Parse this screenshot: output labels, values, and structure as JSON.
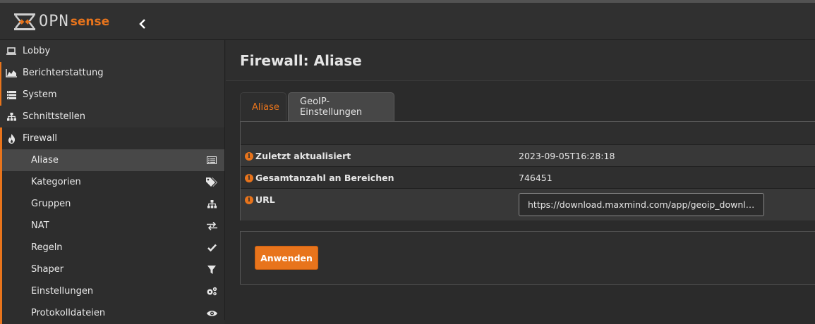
{
  "brand": {
    "logo_text": "OPN",
    "logo_sense": "sense",
    "accent_color": "#e8741c"
  },
  "topbar": {
    "collapse_icon": "chevron-left-icon"
  },
  "sidebar": {
    "items": [
      {
        "label": "Lobby",
        "icon": "laptop-icon"
      },
      {
        "label": "Berichterstattung",
        "icon": "area-chart-icon"
      },
      {
        "label": "System",
        "icon": "server-icon"
      },
      {
        "label": "Schnittstellen",
        "icon": "sitemap-icon"
      },
      {
        "label": "Firewall",
        "icon": "fire-icon"
      }
    ],
    "firewall_sub": [
      {
        "label": "Aliase",
        "icon": "list-alt-icon"
      },
      {
        "label": "Kategorien",
        "icon": "tags-icon"
      },
      {
        "label": "Gruppen",
        "icon": "sitemap-icon"
      },
      {
        "label": "NAT",
        "icon": "exchange-icon"
      },
      {
        "label": "Regeln",
        "icon": "check-icon"
      },
      {
        "label": "Shaper",
        "icon": "filter-icon"
      },
      {
        "label": "Einstellungen",
        "icon": "cogs-icon"
      },
      {
        "label": "Protokolldateien",
        "icon": "eye-icon"
      }
    ]
  },
  "main": {
    "title": "Firewall: Aliase",
    "tabs": [
      {
        "label": "Aliase"
      },
      {
        "label": "GeoIP-Einstellungen"
      }
    ],
    "rows": [
      {
        "label": "Zuletzt aktualisiert",
        "value": "2023-09-05T16:28:18"
      },
      {
        "label": "Gesamtanzahl an Bereichen",
        "value": "746451"
      },
      {
        "label": "URL",
        "value": "https://download.maxmind.com/app/geoip_downlo..."
      }
    ],
    "apply_label": "Anwenden"
  }
}
